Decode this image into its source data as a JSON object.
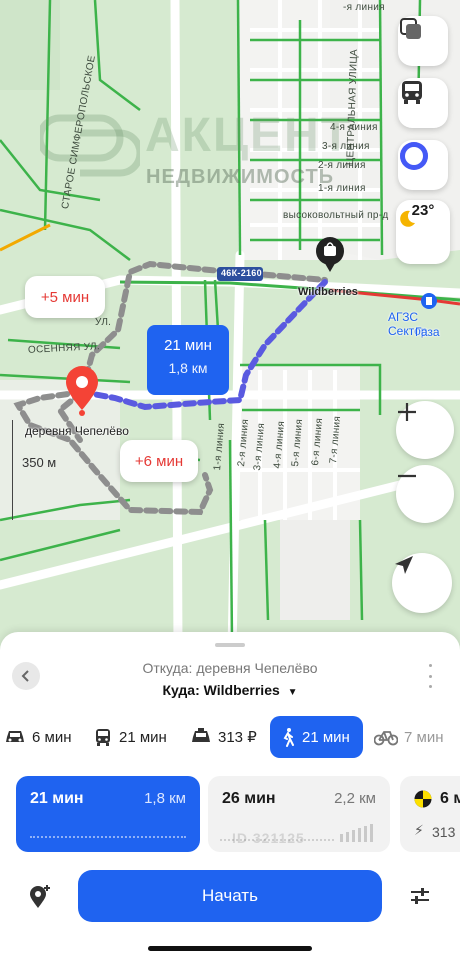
{
  "watermark": {
    "title": "АКЦЕНТ",
    "subtitle": "НЕДВИЖИМОСТЬ",
    "id_text": "ID 321125"
  },
  "map": {
    "street_labels": {
      "staroe_simferopolskoe": "СТАРОЕ СИМФЕРОПОЛЬСКОЕ",
      "centralnaya": "ЦЕНТРАЛЬНАЯ УЛИЦА",
      "liniya_top": "-я линия",
      "liniya_4": "4-я линия",
      "liniya_3": "3-я линия",
      "liniya_2": "2-я линия",
      "liniya_1": "1-я линия",
      "vysokovoltny": "высоковольтный пр-д",
      "road_code": "46К-2160",
      "osennyaya": "ОСЕННЯЯ УЛ.",
      "ul_fragment": "УЛ.",
      "lower_lines": [
        "1-я линия",
        "2-я линия",
        "3-я линия",
        "4-я линия",
        "5-я линия",
        "6-я линия",
        "7-я линия"
      ]
    },
    "places": {
      "wildberries": "Wildberries",
      "gas_station_line1": "АГЗС Сектор",
      "gas_station_line2": "Газа",
      "origin": "деревня Чепелёво"
    },
    "weather": {
      "temp": "23°",
      "icon": "moon-icon"
    },
    "route_bubble": {
      "time": "21 мин",
      "distance": "1,8 км"
    },
    "alt_bubbles": {
      "top": "+5 мин",
      "bottom": "+6 мин"
    },
    "scale": "350 м",
    "colors": {
      "route": "#5a5ae0",
      "accent": "#1f63f0",
      "alt_text": "#e53935",
      "pin": "#f44336"
    }
  },
  "sheet": {
    "from": "Откуда: деревня Чепелёво",
    "to": "Куда: Wildberries",
    "modes": [
      {
        "name": "car",
        "label": "6 мин"
      },
      {
        "name": "bus",
        "label": "21 мин"
      },
      {
        "name": "taxi",
        "label": "313 ₽"
      },
      {
        "name": "walk",
        "label": "21 мин"
      },
      {
        "name": "bike",
        "label": "7 мин"
      }
    ],
    "routes": [
      {
        "time": "21 мин",
        "distance": "1,8 км"
      },
      {
        "time": "26 мин",
        "distance": "2,2 км"
      },
      {
        "time": "6 м",
        "price": "313"
      }
    ],
    "start": "Начать"
  }
}
